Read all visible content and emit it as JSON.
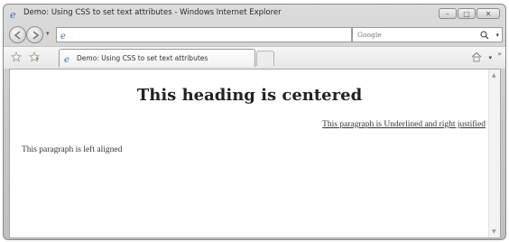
{
  "window": {
    "title": "Demo: Using CSS to set text attributes - Windows Internet Explorer",
    "minimize_glyph": "–",
    "maximize_glyph": "□",
    "close_glyph": "✕"
  },
  "nav": {
    "back_icon": "back-arrow-icon",
    "forward_icon": "forward-arrow-icon",
    "address_value": "",
    "refresh_glyph": "↻",
    "stop_glyph": "✕",
    "search_placeholder": "Google"
  },
  "tabs": [
    {
      "label": "Demo: Using CSS to set text attributes"
    }
  ],
  "page": {
    "heading": "This heading is centered",
    "right_paragraph": "This paragraph is Underlined and right justified",
    "left_paragraph": "This paragraph is left aligned"
  }
}
